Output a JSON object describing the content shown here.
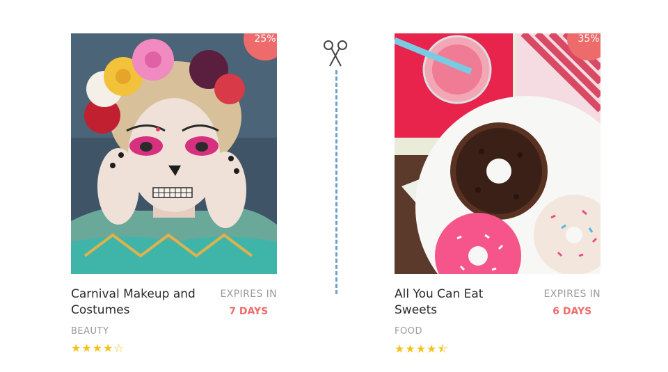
{
  "deals": [
    {
      "title": "Carnival Makeup and Costumes",
      "category": "BEAUTY",
      "discount": "25%",
      "expires_label": "EXPIRES IN",
      "expires_days": "7 DAYS",
      "rating": 4,
      "stars_text": "★★★★☆",
      "image": "woman-carnival-sugar-skull-makeup-photo"
    },
    {
      "title": "All You Can Eat Sweets",
      "category": "FOOD",
      "discount": "35%",
      "expires_label": "EXPIRES IN",
      "expires_days": "6 DAYS",
      "rating": 4.5,
      "stars_text": "★★★★⯪",
      "image": "donuts-on-plate-photo"
    }
  ],
  "divider": {
    "icon": "scissors-icon"
  },
  "colors": {
    "accent": "#ee6b6b",
    "star": "#f3c21a",
    "dash": "#6fa1c6"
  }
}
